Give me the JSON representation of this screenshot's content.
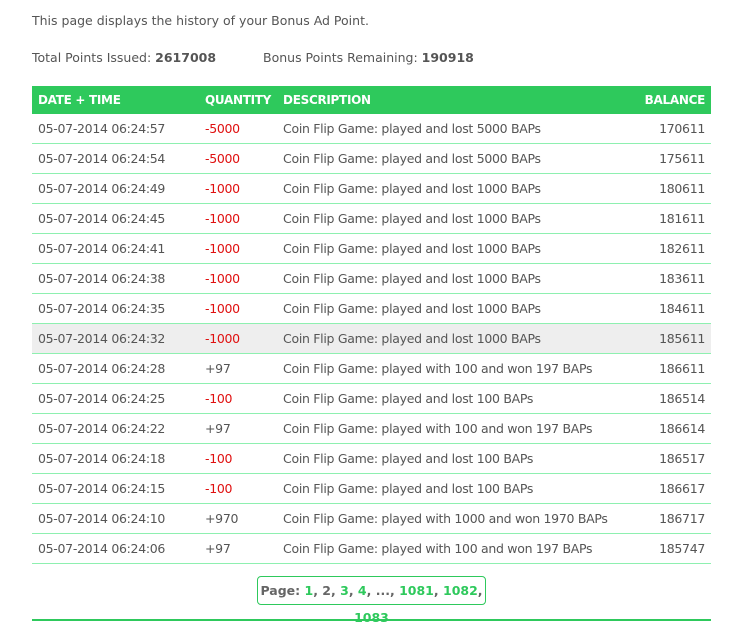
{
  "intro": "This page displays the history of your Bonus Ad Point.",
  "totals": {
    "issued_label": "Total Points Issued:",
    "issued": "2617008",
    "remaining_label": "Bonus Points Remaining:",
    "remaining": "190918"
  },
  "columns": [
    "DATE + TIME",
    "QUANTITY",
    "DESCRIPTION",
    "BALANCE"
  ],
  "rows": [
    [
      "05-07-2014 06:24:57",
      "-5000",
      "Coin Flip Game: played and lost 5000 BAPs",
      "170611"
    ],
    [
      "05-07-2014 06:24:54",
      "-5000",
      "Coin Flip Game: played and lost 5000 BAPs",
      "175611"
    ],
    [
      "05-07-2014 06:24:49",
      "-1000",
      "Coin Flip Game: played and lost 1000 BAPs",
      "180611"
    ],
    [
      "05-07-2014 06:24:45",
      "-1000",
      "Coin Flip Game: played and lost 1000 BAPs",
      "181611"
    ],
    [
      "05-07-2014 06:24:41",
      "-1000",
      "Coin Flip Game: played and lost 1000 BAPs",
      "182611"
    ],
    [
      "05-07-2014 06:24:38",
      "-1000",
      "Coin Flip Game: played and lost 1000 BAPs",
      "183611"
    ],
    [
      "05-07-2014 06:24:35",
      "-1000",
      "Coin Flip Game: played and lost 1000 BAPs",
      "184611"
    ],
    [
      "05-07-2014 06:24:32",
      "-1000",
      "Coin Flip Game: played and lost 1000 BAPs",
      "185611"
    ],
    [
      "05-07-2014 06:24:28",
      "+97",
      "Coin Flip Game: played with 100 and won 197 BAPs",
      "186611"
    ],
    [
      "05-07-2014 06:24:25",
      "-100",
      "Coin Flip Game: played and lost 100 BAPs",
      "186514"
    ],
    [
      "05-07-2014 06:24:22",
      "+97",
      "Coin Flip Game: played with 100 and won 197 BAPs",
      "186614"
    ],
    [
      "05-07-2014 06:24:18",
      "-100",
      "Coin Flip Game: played and lost 100 BAPs",
      "186517"
    ],
    [
      "05-07-2014 06:24:15",
      "-100",
      "Coin Flip Game: played and lost 100 BAPs",
      "186617"
    ],
    [
      "05-07-2014 06:24:10",
      "+970",
      "Coin Flip Game: played with 1000 and won 1970 BAPs",
      "186717"
    ],
    [
      "05-07-2014 06:24:06",
      "+97",
      "Coin Flip Game: played with 100 and won 197 BAPs",
      "185747"
    ]
  ],
  "pager": {
    "label": "Page:",
    "pages": [
      "1",
      "2",
      "3",
      "4",
      "...",
      "1081",
      "1082",
      "1083"
    ],
    "current": "2"
  },
  "colors": {
    "accent": "#2ec95c",
    "negative": "#e01010"
  }
}
